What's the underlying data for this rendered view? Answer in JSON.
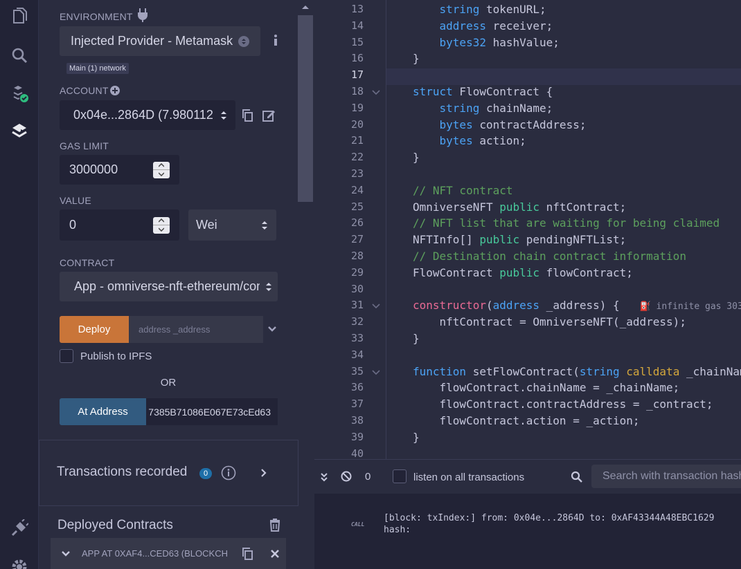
{
  "rail": {
    "icons": [
      "file-explorer-icon",
      "search-icon",
      "compiler-icon",
      "deploy-run-icon",
      "plugin-manager-icon",
      "settings-icon"
    ]
  },
  "panel": {
    "environment_label": "ENVIRONMENT",
    "environment_value": "Injected Provider - Metamask",
    "network_badge": "Main (1) network",
    "account_label": "ACCOUNT",
    "account_value": "0x04e...2864D (7.980112",
    "gas_limit_label": "GAS LIMIT",
    "gas_limit_value": "3000000",
    "value_label": "VALUE",
    "value_amount": "0",
    "value_unit": "Wei",
    "contract_label": "CONTRACT",
    "contract_value": "App - omniverse-nft-ethereum/con",
    "deploy_label": "Deploy",
    "deploy_placeholder": "address _address",
    "publish_label": "Publish to IPFS",
    "or_label": "OR",
    "at_address_label": "At Address",
    "at_address_value": "7385B71086E067E73cEd63",
    "transactions_label": "Transactions recorded",
    "transactions_count": "0",
    "deployed_label": "Deployed Contracts",
    "deployed_item": "APP AT 0XAF4...CED63 (BLOCKCH"
  },
  "editor": {
    "lines": [
      {
        "n": "13",
        "parts": [
          [
            "t",
            "    "
          ],
          [
            "ty",
            "string"
          ],
          [
            "t",
            " tokenURL;"
          ]
        ]
      },
      {
        "n": "14",
        "parts": [
          [
            "t",
            "    "
          ],
          [
            "ty",
            "address"
          ],
          [
            "t",
            " receiver;"
          ]
        ]
      },
      {
        "n": "15",
        "parts": [
          [
            "t",
            "    "
          ],
          [
            "ty",
            "bytes32"
          ],
          [
            "t",
            " hashValue;"
          ]
        ]
      },
      {
        "n": "16",
        "parts": [
          [
            "t",
            "}"
          ]
        ]
      },
      {
        "n": "17",
        "parts": []
      },
      {
        "n": "18",
        "parts": [
          [
            "kw",
            "struct"
          ],
          [
            "t",
            " FlowContract {"
          ]
        ]
      },
      {
        "n": "19",
        "parts": [
          [
            "t",
            "    "
          ],
          [
            "ty",
            "string"
          ],
          [
            "t",
            " chainName;"
          ]
        ]
      },
      {
        "n": "20",
        "parts": [
          [
            "t",
            "    "
          ],
          [
            "ty",
            "bytes"
          ],
          [
            "t",
            " contractAddress;"
          ]
        ]
      },
      {
        "n": "21",
        "parts": [
          [
            "t",
            "    "
          ],
          [
            "ty",
            "bytes"
          ],
          [
            "t",
            " action;"
          ]
        ]
      },
      {
        "n": "22",
        "parts": [
          [
            "t",
            "}"
          ]
        ]
      },
      {
        "n": "23",
        "parts": []
      },
      {
        "n": "24",
        "parts": [
          [
            "cm",
            "// NFT contract"
          ]
        ]
      },
      {
        "n": "25",
        "parts": [
          [
            "t",
            "OmniverseNFT "
          ],
          [
            "pub",
            "public"
          ],
          [
            "t",
            " nftContract;"
          ]
        ]
      },
      {
        "n": "26",
        "parts": [
          [
            "cm",
            "// NFT list that are waiting for being claimed"
          ]
        ]
      },
      {
        "n": "27",
        "parts": [
          [
            "t",
            "NFTInfo[] "
          ],
          [
            "pub",
            "public"
          ],
          [
            "t",
            " pendingNFTList;"
          ]
        ]
      },
      {
        "n": "28",
        "parts": [
          [
            "cm",
            "// Destination chain contract information"
          ]
        ]
      },
      {
        "n": "29",
        "parts": [
          [
            "t",
            "FlowContract "
          ],
          [
            "pub",
            "public"
          ],
          [
            "t",
            " flowContract;"
          ]
        ]
      },
      {
        "n": "30",
        "parts": []
      },
      {
        "n": "31",
        "parts": [
          [
            "ctor",
            "constructor"
          ],
          [
            "t",
            "("
          ],
          [
            "ty",
            "address"
          ],
          [
            "t",
            " _address) {   "
          ],
          [
            "hint",
            "⛽ infinite gas 303"
          ]
        ]
      },
      {
        "n": "32",
        "parts": [
          [
            "t",
            "    nftContract = OmniverseNFT(_address);"
          ]
        ]
      },
      {
        "n": "33",
        "parts": [
          [
            "t",
            "}"
          ]
        ]
      },
      {
        "n": "34",
        "parts": []
      },
      {
        "n": "35",
        "parts": [
          [
            "kw",
            "function"
          ],
          [
            "t",
            " setFlowContract("
          ],
          [
            "ty",
            "string"
          ],
          [
            "t",
            " "
          ],
          [
            "cd",
            "calldata"
          ],
          [
            "t",
            " _chainName"
          ]
        ]
      },
      {
        "n": "36",
        "parts": [
          [
            "t",
            "    flowContract.chainName = _chainName;"
          ]
        ]
      },
      {
        "n": "37",
        "parts": [
          [
            "t",
            "    flowContract.contractAddress = _contract;"
          ]
        ]
      },
      {
        "n": "38",
        "parts": [
          [
            "t",
            "    flowContract.action = _action;"
          ]
        ]
      },
      {
        "n": "39",
        "parts": [
          [
            "t",
            "}"
          ]
        ]
      },
      {
        "n": "40",
        "parts": []
      }
    ]
  },
  "terminal": {
    "count": "0",
    "listen_label": "listen on all transactions",
    "search_placeholder": "Search with transaction hash or address",
    "call_tag": "CALL",
    "log_line1": "[block: txIndex:] from: 0x04e...2864D to: 0xAF43344A48EBC1629",
    "log_line2": "hash:"
  },
  "colors": {
    "deploy_orange": "#c97539",
    "at_address_blue": "#325b80",
    "success_green": "#2ebd7f",
    "keyword_blue": "#4ca3f5",
    "public_green": "#48c99b",
    "comment_green": "#5da05d",
    "constructor_pink": "#e96a94",
    "calldata_gold": "#d4a73c"
  }
}
